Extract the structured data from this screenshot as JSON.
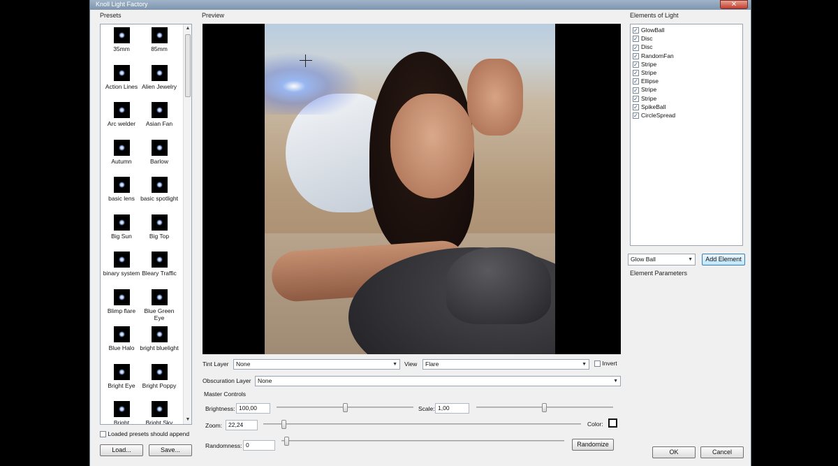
{
  "window": {
    "title": "Knoll Light Factory",
    "close_glyph": "✕"
  },
  "presets": {
    "label": "Presets",
    "items": [
      "35mm",
      "85mm",
      "Action Lines",
      "Alien Jewelry",
      "Arc welder",
      "Asian Fan",
      "Autumn",
      "Barlow",
      "basic lens",
      "basic spotlight",
      "Big Sun",
      "Big Top",
      "binary system",
      "Bleary Traffic",
      "Blimp flare",
      "Blue Green Eye",
      "Blue Halo",
      "bright bluelight",
      "Bright Eye",
      "Bright Poppy",
      "Bright",
      "Bright Sky"
    ],
    "append_label": "Loaded presets should append",
    "append_checked": false,
    "load_label": "Load...",
    "save_label": "Save..."
  },
  "preview": {
    "label": "Preview"
  },
  "tint_layer": {
    "label": "Tint Layer",
    "value": "None"
  },
  "view": {
    "label": "View",
    "value": "Flare",
    "invert_label": "Invert",
    "invert_checked": false
  },
  "obscuration_layer": {
    "label": "Obscuration Layer",
    "value": "None"
  },
  "master_controls": {
    "label": "Master Controls",
    "brightness_label": "Brightness:",
    "brightness_value": "100,00",
    "scale_label": "Scale:",
    "scale_value": "1,00",
    "zoom_label": "Zoom:",
    "zoom_value": "22,24",
    "color_label": "Color:",
    "randomness_label": "Randomness:",
    "randomness_value": "0",
    "randomize_label": "Randomize"
  },
  "elements": {
    "label": "Elements of Light",
    "items": [
      "GlowBall",
      "Disc",
      "Disc",
      "RandomFan",
      "Stripe",
      "Stripe",
      "Ellipse",
      "Stripe",
      "Stripe",
      "SpikeBall",
      "CircleSpread"
    ],
    "add_select_value": "Glow Ball",
    "add_label": "Add Element",
    "params_label": "Element Parameters"
  },
  "dialog": {
    "ok_label": "OK",
    "cancel_label": "Cancel"
  },
  "icons": {
    "scroll_up": "▲",
    "scroll_down": "▼",
    "dropdown": "▼"
  }
}
